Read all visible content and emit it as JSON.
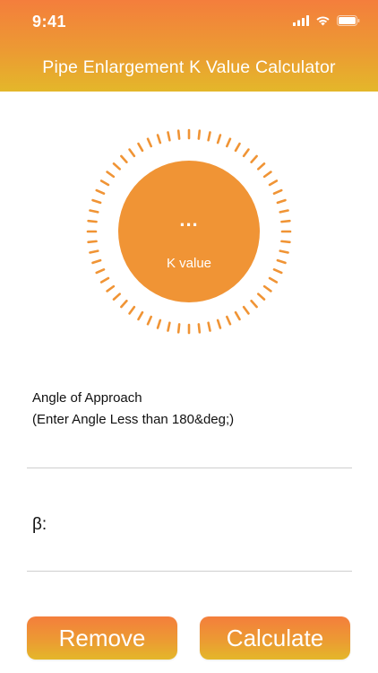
{
  "status_bar": {
    "time": "9:41"
  },
  "header": {
    "title": "Pipe Enlargement K Value Calculator"
  },
  "result": {
    "value": "...",
    "label": "K value"
  },
  "angle_field": {
    "label": "Angle of Approach",
    "hint": "(Enter Angle Less than 180&deg;)",
    "value": "",
    "placeholder": ""
  },
  "beta_field": {
    "label": "β:",
    "value": ""
  },
  "buttons": {
    "remove_label": "Remove",
    "calculate_label": "Calculate"
  },
  "colors": {
    "gradient_top": "#f47e3c",
    "gradient_bottom": "#e4b72a",
    "accent": "#f09435"
  },
  "icons": {
    "signal": "cellular-signal-icon",
    "wifi": "wifi-icon",
    "battery": "battery-icon"
  }
}
